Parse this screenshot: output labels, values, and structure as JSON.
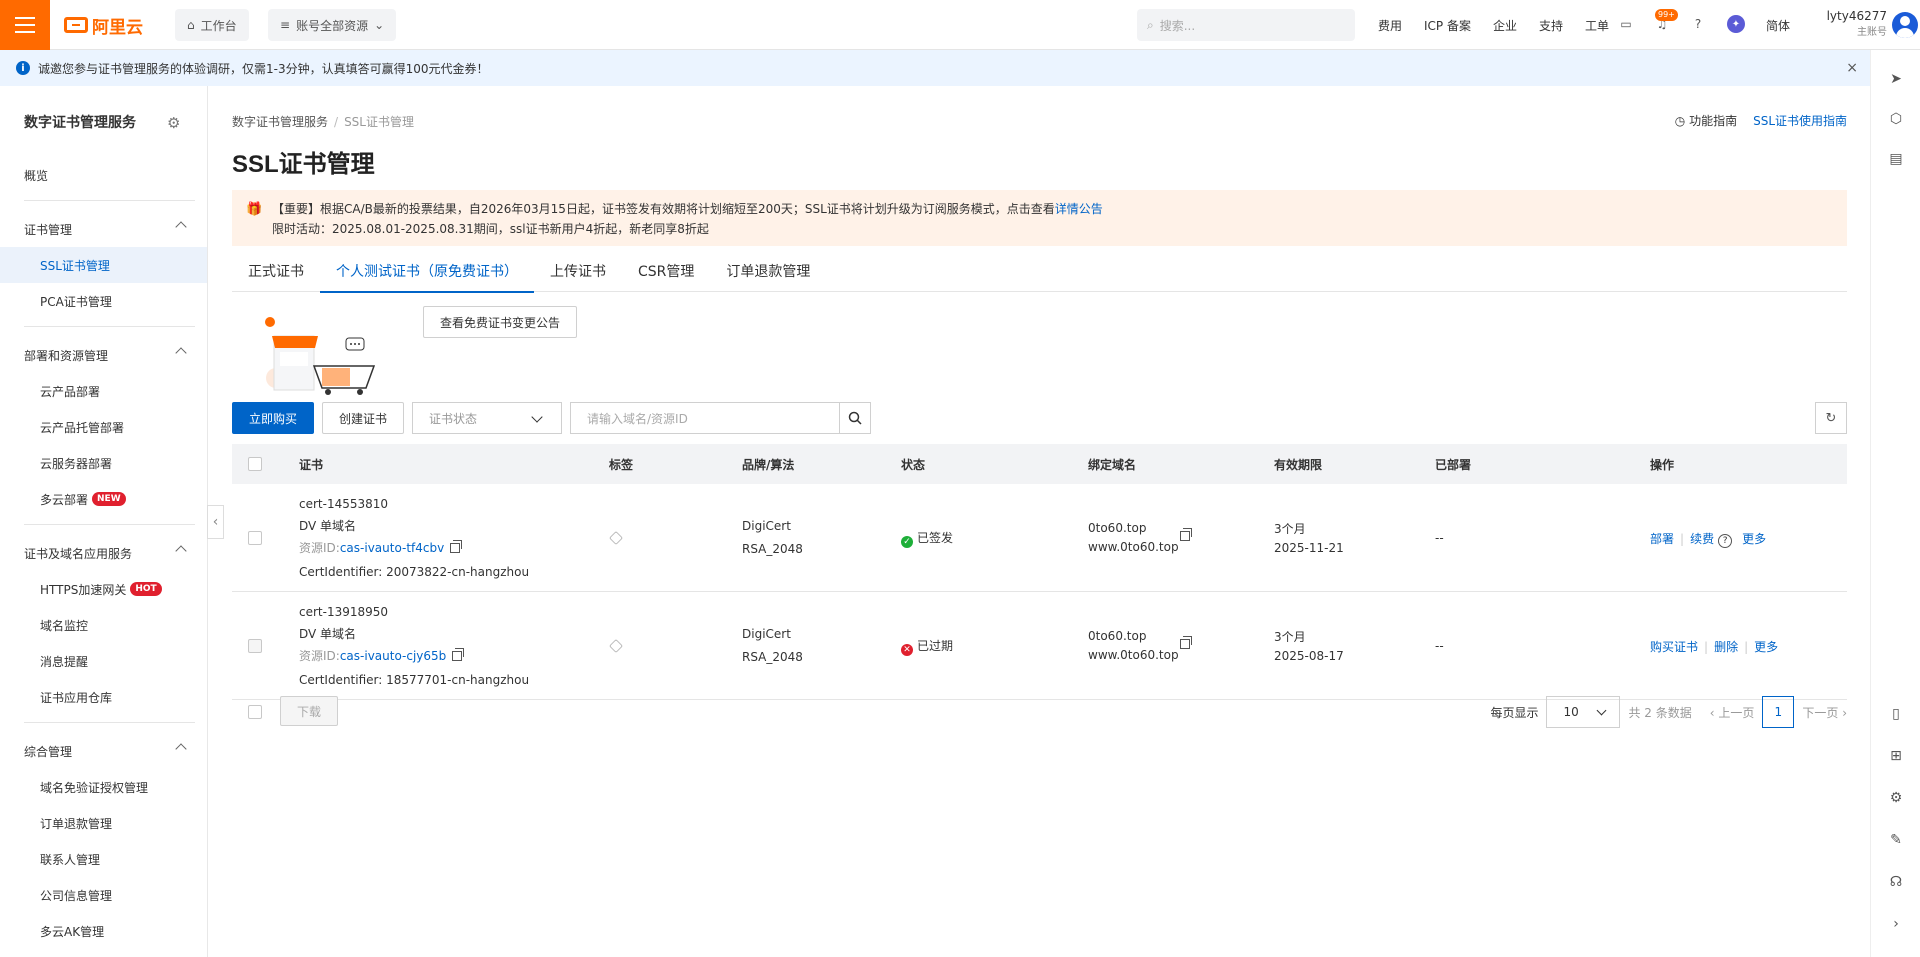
{
  "header": {
    "logo_text": "阿里云",
    "workbench": "工作台",
    "resource_scope": "账号全部资源",
    "search_placeholder": "搜索...",
    "nav": [
      "费用",
      "ICP 备案",
      "企业",
      "支持",
      "工单"
    ],
    "notification_count": "99+",
    "language": "简体",
    "username": "lyty46277",
    "account_type": "主账号"
  },
  "notice": {
    "text": "诚邀您参与证书管理服务的体验调研，仅需1-3分钟，认真填答可赢得100元代金券！",
    "close": "×"
  },
  "sidebar": {
    "title": "数字证书管理服务",
    "overview": "概览",
    "groups": [
      {
        "label": "证书管理",
        "items": [
          "SSL证书管理",
          "PCA证书管理"
        ]
      },
      {
        "label": "部署和资源管理",
        "items": [
          "云产品部署",
          "云产品托管部署",
          "云服务器部署",
          "多云部署"
        ]
      },
      {
        "label": "证书及域名应用服务",
        "items": [
          "HTTPS加速网关",
          "域名监控",
          "消息提醒",
          "证书应用仓库"
        ]
      },
      {
        "label": "综合管理",
        "items": [
          "域名免验证授权管理",
          "订单退款管理",
          "联系人管理",
          "公司信息管理",
          "多云AK管理"
        ]
      }
    ],
    "tag_new": "NEW",
    "tag_hot": "HOT"
  },
  "breadcrumb": {
    "root": "数字证书管理服务",
    "current": "SSL证书管理"
  },
  "top_links": {
    "guide": "功能指南",
    "usage": "SSL证书使用指南"
  },
  "page_title": "SSL证书管理",
  "alert": {
    "line1": "【重要】根据CA/B最新的投票结果，自2026年03月15日起，证书签发有效期将计划缩短至200天；SSL证书将计划升级为订阅服务模式，点击查看",
    "link": "详情公告",
    "line2": "限时活动：2025.08.01-2025.08.31期间，ssl证书新用户4折起，新老同享8折起"
  },
  "tabs": [
    "正式证书",
    "个人测试证书（原免费证书）",
    "上传证书",
    "CSR管理",
    "订单退款管理"
  ],
  "notice_button": "查看免费证书变更公告",
  "toolbar": {
    "buy": "立即购买",
    "create": "创建证书",
    "status_placeholder": "证书状态",
    "search_placeholder": "请输入域名/资源ID"
  },
  "table": {
    "columns": [
      "证书",
      "标签",
      "品牌/算法",
      "状态",
      "绑定域名",
      "有效期限",
      "已部署",
      "操作"
    ],
    "rows": [
      {
        "name": "cert-14553810",
        "type": "DV 单域名",
        "resource_prefix": "资源ID:",
        "resource_id": "cas-ivauto-tf4cbv",
        "cert_identifier": "CertIdentifier: 20073822-cn-hangzhou",
        "brand": "DigiCert",
        "algo": "RSA_2048",
        "status": "已签发",
        "domain1": "0to60.top",
        "domain2": "www.0to60.top",
        "period": "3个月",
        "expire": "2025-11-21",
        "deployed": "--",
        "actions": [
          "部署",
          "续费",
          "更多"
        ]
      },
      {
        "name": "cert-13918950",
        "type": "DV 单域名",
        "resource_prefix": "资源ID:",
        "resource_id": "cas-ivauto-cjy65b",
        "cert_identifier": "CertIdentifier: 18577701-cn-hangzhou",
        "brand": "DigiCert",
        "algo": "RSA_2048",
        "status": "已过期",
        "domain1": "0to60.top",
        "domain2": "www.0to60.top",
        "period": "3个月",
        "expire": "2025-08-17",
        "deployed": "--",
        "actions": [
          "购买证书",
          "删除",
          "更多"
        ]
      }
    ]
  },
  "footer": {
    "download": "下载",
    "per_page_label": "每页显示",
    "per_page": "10",
    "total": "共 2 条数据",
    "prev": "上一页",
    "page": "1",
    "next": "下一页"
  },
  "colors": {
    "brand": "#ff6a00",
    "primary": "#0064c8",
    "success": "#1eaf39",
    "danger": "#e0202e"
  }
}
